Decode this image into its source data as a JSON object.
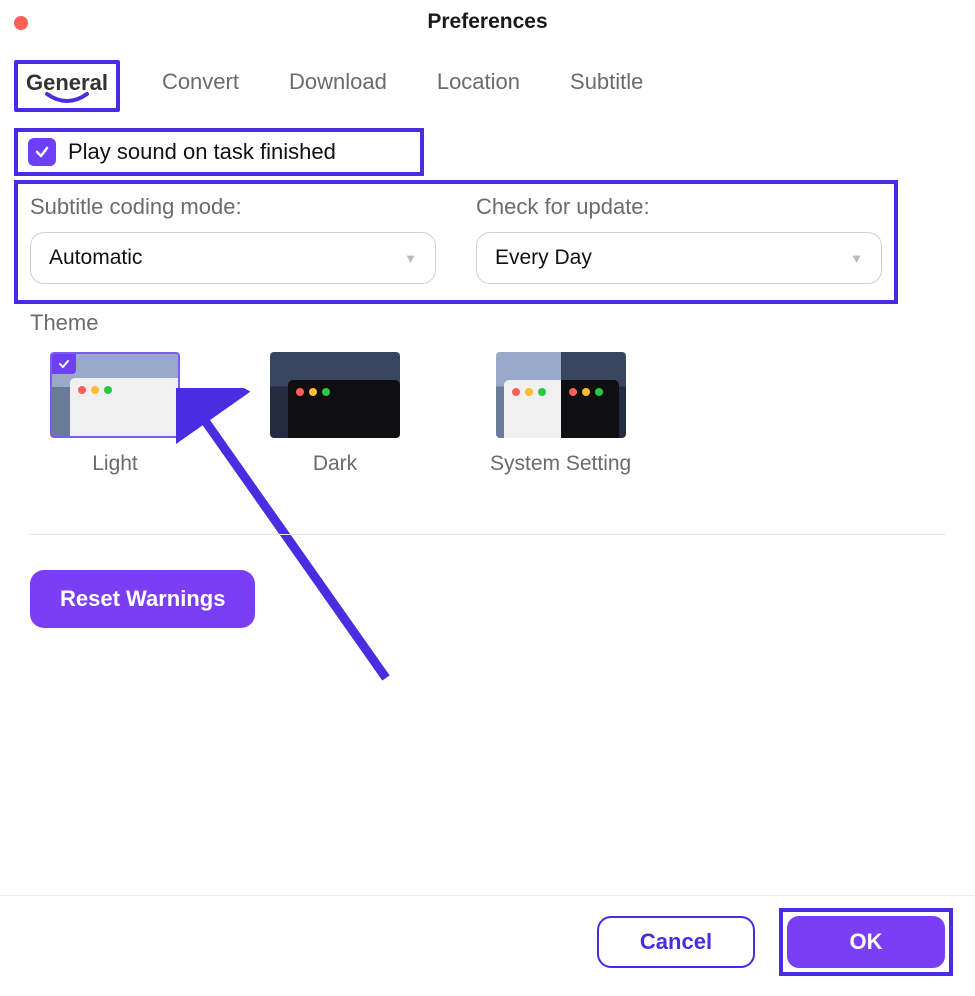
{
  "window": {
    "title": "Preferences"
  },
  "tabs": {
    "items": [
      {
        "label": "General"
      },
      {
        "label": "Convert"
      },
      {
        "label": "Download"
      },
      {
        "label": "Location"
      },
      {
        "label": "Subtitle"
      }
    ],
    "active_index": 0
  },
  "play_sound": {
    "checked": true,
    "label": "Play sound on task finished"
  },
  "subtitle_mode": {
    "label": "Subtitle coding mode:",
    "value": "Automatic"
  },
  "check_update": {
    "label": "Check for update:",
    "value": "Every Day"
  },
  "theme": {
    "label": "Theme",
    "options": [
      {
        "label": "Light"
      },
      {
        "label": "Dark"
      },
      {
        "label": "System Setting"
      }
    ],
    "selected_index": 0
  },
  "buttons": {
    "reset": "Reset Warnings",
    "cancel": "Cancel",
    "ok": "OK"
  },
  "colors": {
    "accent": "#7a3ff5",
    "highlight_border": "#4a2de0"
  }
}
